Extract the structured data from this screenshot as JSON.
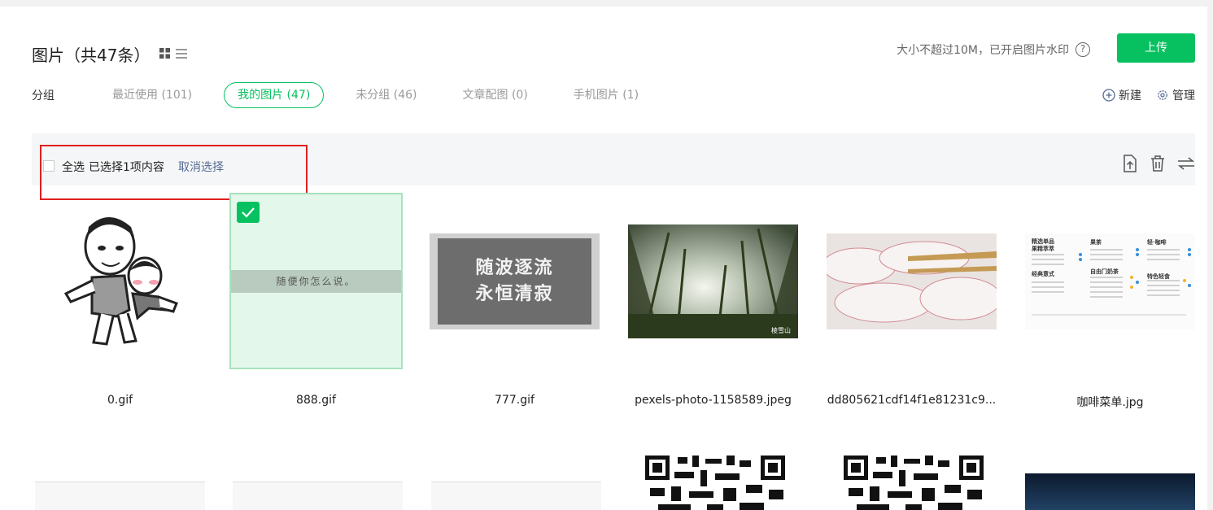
{
  "header": {
    "title": "图片（共47条）",
    "upload_note": "大小不超过10M，已开启图片水印",
    "help_glyph": "?",
    "upload_label": "上传"
  },
  "groups": {
    "label": "分组",
    "tabs": [
      {
        "label": "最近使用 (101)",
        "active": false
      },
      {
        "label": "我的图片 (47)",
        "active": true
      },
      {
        "label": "未分组 (46)",
        "active": false
      },
      {
        "label": "文章配图 (0)",
        "active": false
      },
      {
        "label": "手机图片 (1)",
        "active": false
      }
    ],
    "new_label": "新建",
    "manage_label": "管理"
  },
  "selection": {
    "select_all": "全选",
    "count_text": "已选择1项内容",
    "cancel_label": "取消选择"
  },
  "images": [
    {
      "name": "0.gif",
      "checked": false
    },
    {
      "name": "888.gif",
      "checked": true,
      "caption": "随便你怎么说。"
    },
    {
      "name": "777.gif",
      "checked": false,
      "caption_line1": "随波逐流",
      "caption_line2": "永恒清寂"
    },
    {
      "name": "pexels-photo-1158589.jpeg",
      "checked": false,
      "watermark": "棱雪山"
    },
    {
      "name": "dd805621cdf14f1e81231c9...",
      "checked": false
    },
    {
      "name": "咖啡菜单.jpg",
      "checked": false
    }
  ],
  "menu_thumb": {
    "heading_left": "精选单品",
    "heading_left2": "果精萃萃",
    "heading_mid": "果茶",
    "heading_right": "轻·咖啡",
    "section_a": "经典意式",
    "section_b": "自由门奶茶",
    "section_c": "特色轻食"
  },
  "colors": {
    "accent": "#07c160",
    "link": "#576b95",
    "highlight_box": "#e02020"
  }
}
